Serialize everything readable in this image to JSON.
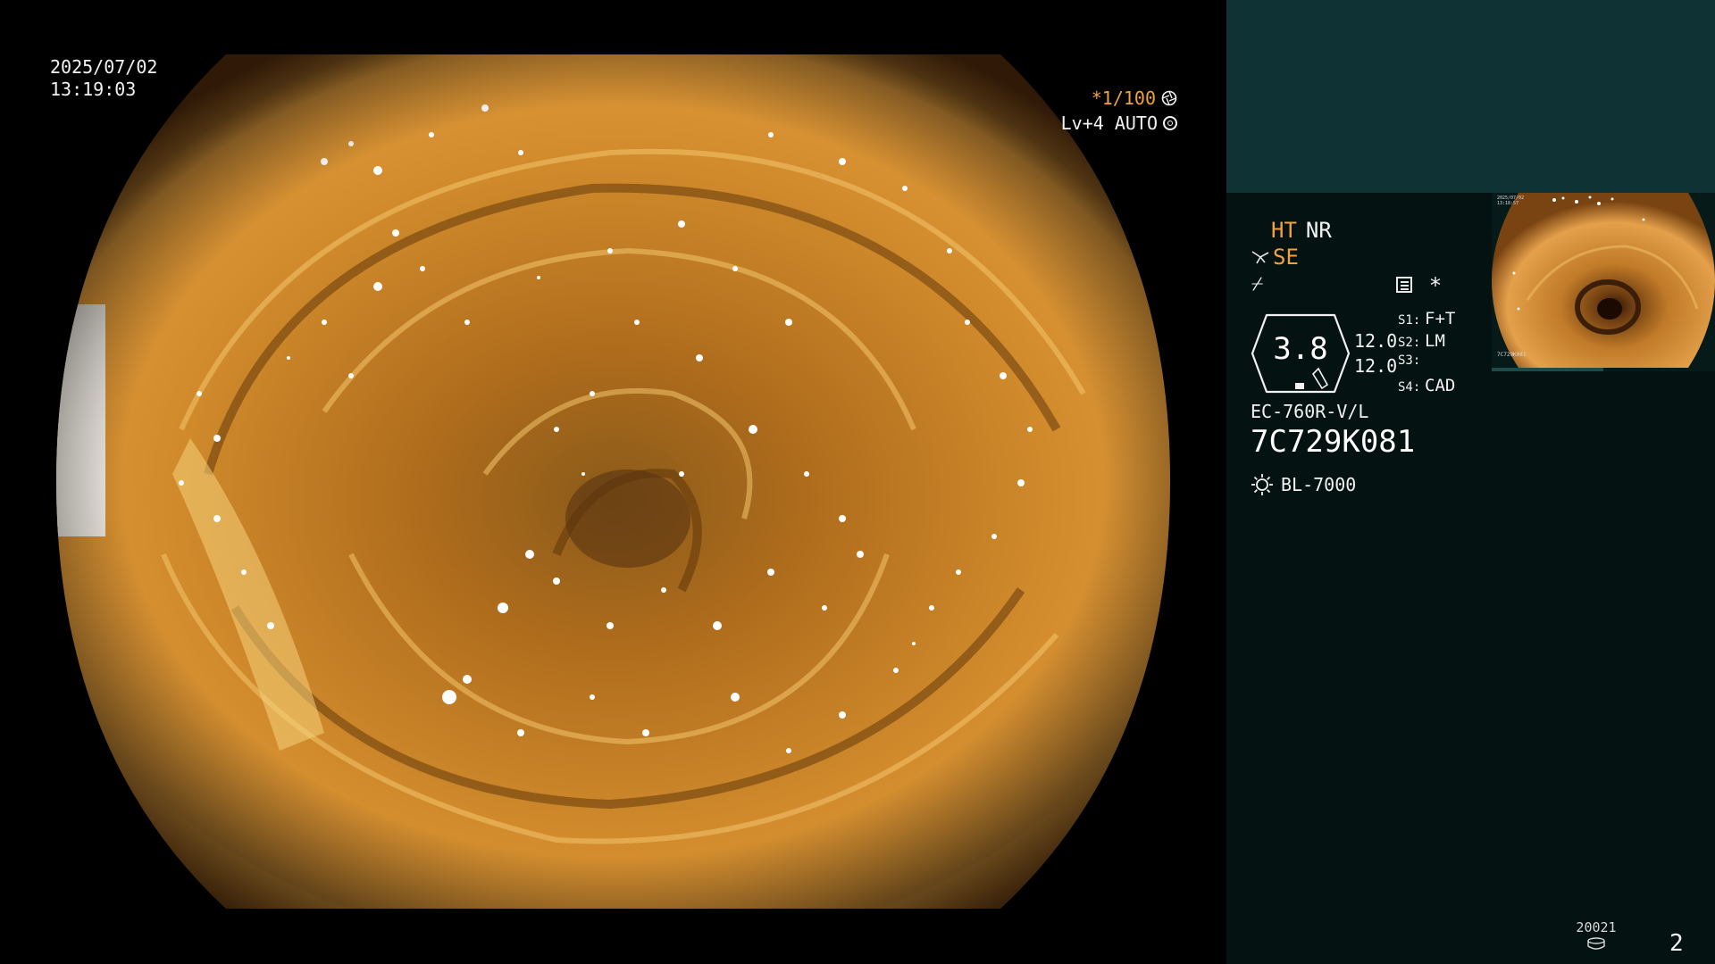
{
  "overlay": {
    "date": "2025/07/02",
    "time": "13:19:03",
    "shutter": "*1/100",
    "iris": "Lv+4 AUTO"
  },
  "panel": {
    "mode_ht": "HT",
    "mode_nr": "NR",
    "mode_se": "SE",
    "flash_symbol": "⌿",
    "star_symbol": "*",
    "gauge_value": "3.8",
    "gauge_sub_1": "12.0",
    "gauge_sub_2": "12.0",
    "switches": [
      {
        "key": "S1:",
        "value": "F+T"
      },
      {
        "key": "S2:",
        "value": "LM"
      },
      {
        "key": "S3:",
        "value": ""
      },
      {
        "key": "S4:",
        "value": "CAD"
      }
    ],
    "scope_model": "EC-760R-V/L",
    "scope_serial": "7C729K081",
    "light_source": "BL-7000",
    "record_count": "20021",
    "page_number": "2"
  },
  "thumbnail": {
    "date": "2025/07/02",
    "time": "13:18:57",
    "serial": "7C729K081"
  },
  "colors": {
    "accent": "#f2a23a",
    "panel_bg": "#041312",
    "panel_top": "#0f3235",
    "tissue": "#c8781e"
  },
  "icons": {
    "aperture": "aperture-icon",
    "iris_ring": "ring-icon",
    "scissors": "scissors-icon",
    "flash": "flash-icon",
    "menu": "menu-icon",
    "light": "sun-icon",
    "disk": "disk-icon"
  }
}
